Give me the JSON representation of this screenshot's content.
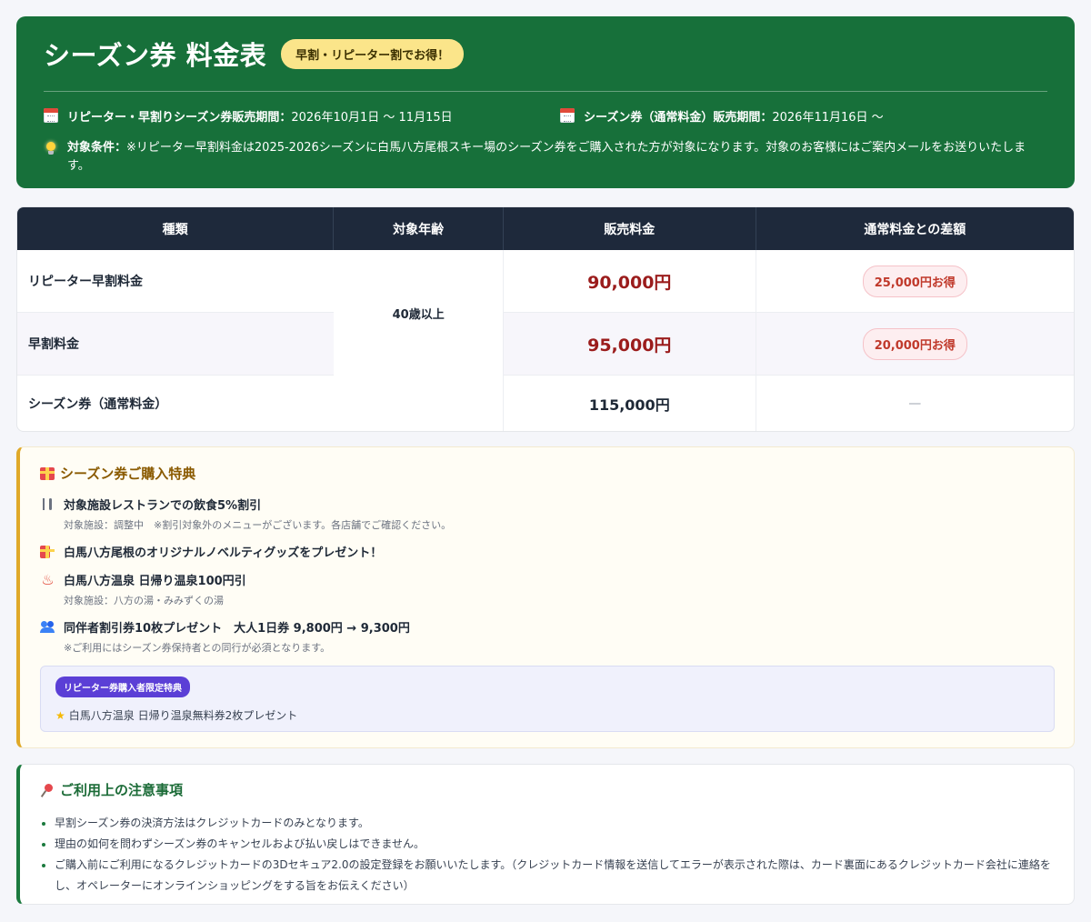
{
  "header": {
    "title": "シーズン券 料金表",
    "badge": "早割・リピーター割でお得！",
    "periods": [
      {
        "label": "リピーター・早割りシーズン券販売期間：",
        "value": "2026年10月1日 〜 11月15日"
      },
      {
        "label": "シーズン券（通常料金）販売期間：",
        "value": "2026年11月16日 〜"
      }
    ],
    "condition_label": "対象条件：",
    "condition_text": "※リピーター早割料金は2025-2026シーズンに白馬八方尾根スキー場のシーズン券をご購入された方が対象になります。対象のお客様にはご案内メールをお送りいたします。"
  },
  "table": {
    "columns": [
      "種類",
      "対象年齢",
      "販売料金",
      "通常料金との差額"
    ],
    "age": "40歳以上",
    "rows": [
      {
        "type": "リピーター早割料金",
        "price": "90,000円",
        "diff": "25,000円お得"
      },
      {
        "type": "早割料金",
        "price": "95,000円",
        "diff": "20,000円お得"
      },
      {
        "type": "シーズン券（通常料金）",
        "price": "115,000円",
        "diff": "—"
      }
    ]
  },
  "benefits": {
    "title": "シーズン券ご購入特典",
    "items": [
      {
        "icon": "fork-knife-icon",
        "text": "対象施設レストランでの飲食5%割引",
        "sub": "対象施設：調整中　※割引対象外のメニューがございます。各店舗でご確認ください。"
      },
      {
        "icon": "gift-icon",
        "text": "白馬八方尾根のオリジナルノベルティグッズをプレゼント！",
        "sub": ""
      },
      {
        "icon": "hot-spring-icon",
        "text": "白馬八方温泉 日帰り温泉100円引",
        "sub": "対象施設：八方の湯・みみずくの湯"
      },
      {
        "icon": "people-icon",
        "text": "同伴者割引券10枚プレゼント　大人1日券 9,800円 → 9,300円",
        "sub": "※ご利用にはシーズン券保持者との同行が必須となります。"
      }
    ],
    "repeater_badge": "リピーター券購入者限定特典",
    "repeater_text": "白馬八方温泉 日帰り温泉無料券2枚プレゼント"
  },
  "notes": {
    "title": "ご利用上の注意事項",
    "items": [
      "早割シーズン券の決済方法はクレジットカードのみとなります。",
      "理由の如何を問わずシーズン券のキャンセルおよび払い戻しはできません。",
      "ご購入前にご利用になるクレジットカードの3Dセキュア2.0の設定登録をお願いいたします。（クレジットカード情報を送信してエラーが表示された際は、カード裏面にあるクレジットカード会社に連絡をし、オペレーターにオンラインショッピングをする旨をお伝えください）"
    ]
  },
  "colors": {
    "header_bg": "#17703a",
    "badge_bg": "#fbe58a",
    "table_head_bg": "#1e293b",
    "price_highlight": "#9b1c1c",
    "benefits_accent": "#e0a928",
    "repeater_badge_bg": "#5b3fd6",
    "notes_accent": "#1b7a3e"
  }
}
